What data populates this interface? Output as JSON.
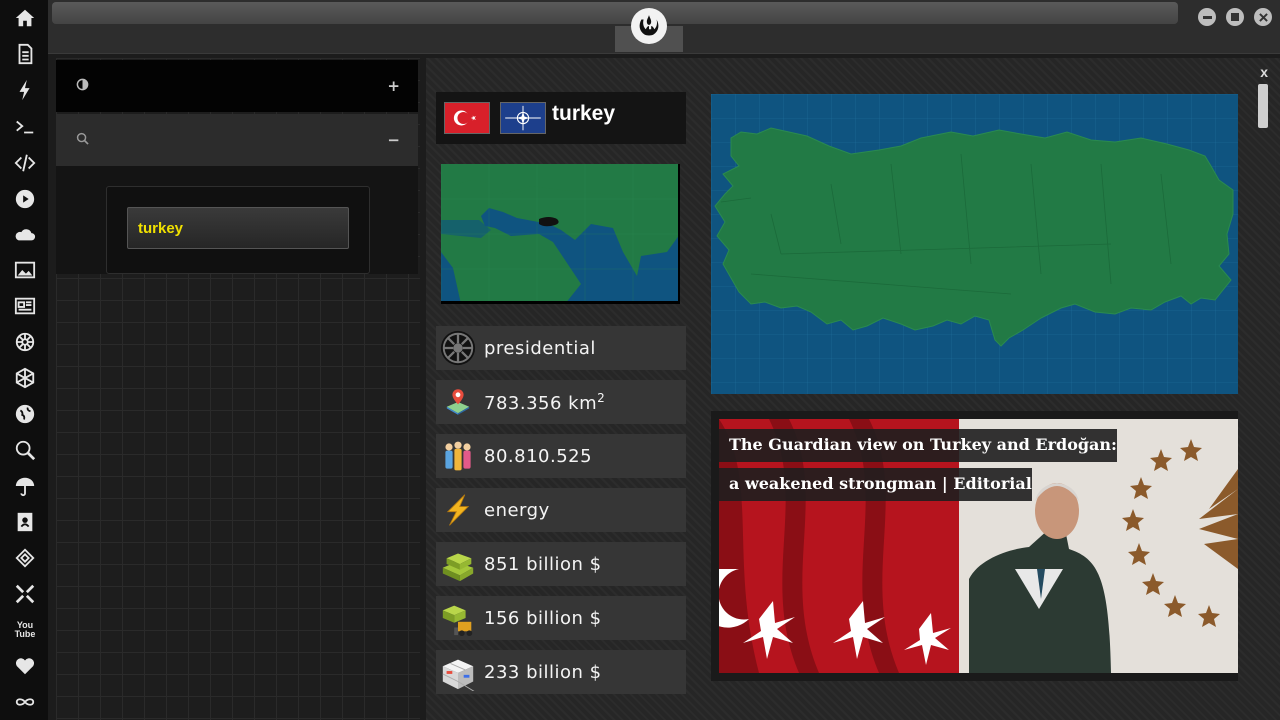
{
  "rail": {
    "icons": [
      "home-icon",
      "document-icon",
      "lightning-icon",
      "terminal-icon",
      "code-icon",
      "play-icon",
      "cloud-icon",
      "image-icon",
      "newspaper-icon",
      "empire-icon",
      "hexagon-icon",
      "globe-icon",
      "search-icon",
      "umbrella-icon",
      "contacts-icon",
      "tag-icon",
      "expand-icon",
      "youtube-icon",
      "heart-icon",
      "infinity-icon"
    ],
    "youtube_label": "You\nTube"
  },
  "left_panel": {
    "row1_toggle": "+",
    "row2_toggle": "−",
    "search": {
      "value": "turkey"
    }
  },
  "main": {
    "close_label": "x",
    "country": {
      "name": "turkey",
      "government": "presidential",
      "area": "783.356 km",
      "area_unit_sup": "2",
      "population": "80.810.525",
      "resource": "energy",
      "gdp": "851 billion $",
      "exports": "156 billion $",
      "imports": "233 billion $"
    },
    "news": {
      "title": "The Guardian view on Turkey and Erdoğan: a weakened strongman | Editorial"
    }
  },
  "colors": {
    "accent_text": "#f0e000",
    "map_sea": "#0f5480",
    "map_land": "#227a45",
    "flag_red": "#d8202a",
    "nato_blue": "#1d3f8c"
  }
}
